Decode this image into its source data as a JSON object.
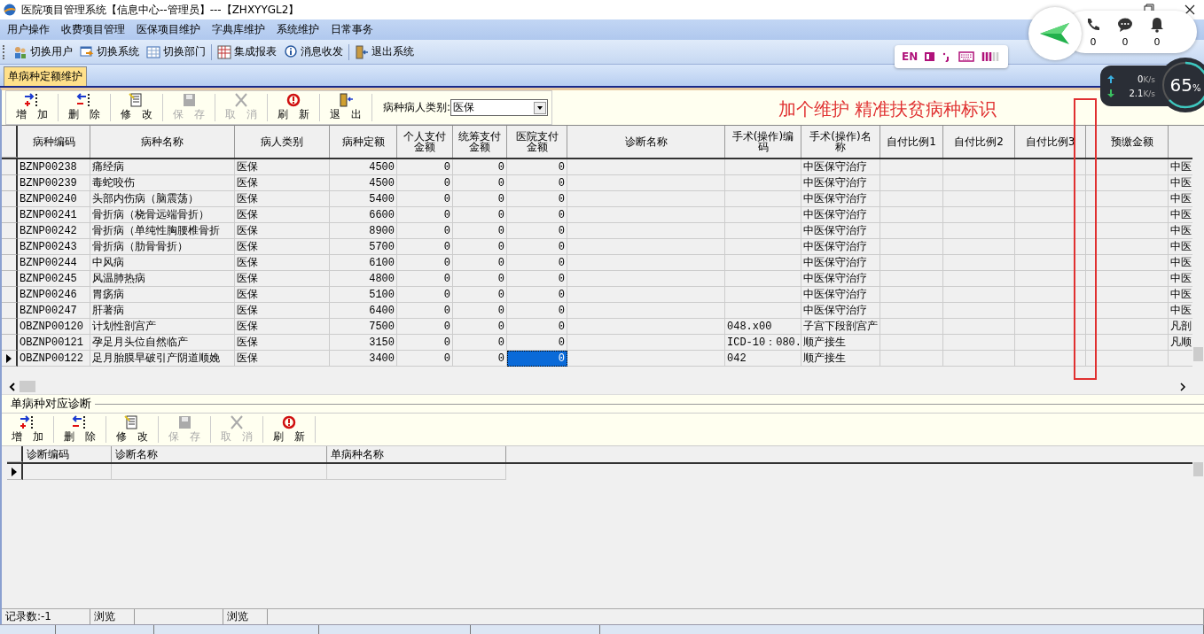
{
  "window": {
    "title": "医院项目管理系统【信息中心--管理员】---【ZHXYYGL2】"
  },
  "menu": [
    "用户操作",
    "收费项目管理",
    "医保项目维护",
    "字典库维护",
    "系统维护",
    "日常事务"
  ],
  "toolbar": [
    {
      "label": "切换用户",
      "kind": "user",
      "separator_before": false
    },
    {
      "label": "切换系统",
      "kind": "system",
      "separator_before": false
    },
    {
      "label": "切换部门",
      "kind": "dept",
      "separator_before": false
    },
    {
      "label": "集成报表",
      "kind": "report",
      "separator_before": true
    },
    {
      "label": "消息收发",
      "kind": "message",
      "separator_before": false
    },
    {
      "label": "退出系统",
      "kind": "exit",
      "separator_before": true
    }
  ],
  "tabs": [
    {
      "label": "单病种定额维护",
      "selected": true
    }
  ],
  "panel_toolbar": [
    {
      "label": "增加",
      "kind": "add",
      "disabled": false
    },
    {
      "label": "删除",
      "kind": "delete",
      "disabled": false
    },
    {
      "label": "修改",
      "kind": "edit",
      "disabled": false
    },
    {
      "label": "保存",
      "kind": "save",
      "disabled": true
    },
    {
      "label": "取消",
      "kind": "cancel",
      "disabled": true
    },
    {
      "label": "刷新",
      "kind": "refresh",
      "disabled": false
    },
    {
      "label": "退出",
      "kind": "exit",
      "disabled": false
    }
  ],
  "filter": {
    "label": "病种病人类别:",
    "value": "医保"
  },
  "annotation": "加个维护  精准扶贫病种标识",
  "grid": {
    "columns": [
      {
        "label": "病种编码",
        "focused": false
      },
      {
        "label": "病种名称",
        "focused": false
      },
      {
        "label": "病人类别",
        "focused": false
      },
      {
        "label": "病种定额",
        "focused": false
      },
      {
        "label": "个人支付金额",
        "focused": false
      },
      {
        "label": "统筹支付金额",
        "focused": false
      },
      {
        "label": "医院支付金额",
        "focused": true
      },
      {
        "label": "诊断名称",
        "focused": false
      },
      {
        "label": "手术(操作)编码",
        "focused": false
      },
      {
        "label": "手术(操作)名称",
        "focused": false
      },
      {
        "label": "自付比例1",
        "focused": false
      },
      {
        "label": "自付比例2",
        "focused": false
      },
      {
        "label": "自付比例3",
        "focused": false
      },
      {
        "label": "预缴金额",
        "focused": false
      }
    ],
    "rows": [
      {
        "selected": false,
        "code": "BZNP00238",
        "name": "痛经病",
        "patient_type": "医保",
        "quota": "4500",
        "personal_pay": "0",
        "pooled_pay": "0",
        "hospital_pay": "0",
        "surgery_name": "中医保守治疗",
        "column_17": "中医"
      },
      {
        "selected": false,
        "code": "BZNP00239",
        "name": "毒蛇咬伤",
        "patient_type": "医保",
        "quota": "4500",
        "personal_pay": "0",
        "pooled_pay": "0",
        "hospital_pay": "0",
        "surgery_name": "中医保守治疗",
        "column_17": "中医"
      },
      {
        "selected": false,
        "code": "BZNP00240",
        "name": "头部内伤病（脑震荡）",
        "patient_type": "医保",
        "quota": "5400",
        "personal_pay": "0",
        "pooled_pay": "0",
        "hospital_pay": "0",
        "surgery_name": "中医保守治疗",
        "column_17": "中医"
      },
      {
        "selected": false,
        "code": "BZNP00241",
        "name": "骨折病（桡骨远端骨折）",
        "patient_type": "医保",
        "quota": "6600",
        "personal_pay": "0",
        "pooled_pay": "0",
        "hospital_pay": "0",
        "surgery_name": "中医保守治疗",
        "column_17": "中医"
      },
      {
        "selected": false,
        "code": "BZNP00242",
        "name": "骨折病（单纯性胸腰椎骨折",
        "patient_type": "医保",
        "quota": "8900",
        "personal_pay": "0",
        "pooled_pay": "0",
        "hospital_pay": "0",
        "surgery_name": "中医保守治疗",
        "column_17": "中医"
      },
      {
        "selected": false,
        "code": "BZNP00243",
        "name": "骨折病（肋骨骨折）",
        "patient_type": "医保",
        "quota": "5700",
        "personal_pay": "0",
        "pooled_pay": "0",
        "hospital_pay": "0",
        "surgery_name": "中医保守治疗",
        "column_17": "中医"
      },
      {
        "selected": false,
        "code": "BZNP00244",
        "name": "中风病",
        "patient_type": "医保",
        "quota": "6100",
        "personal_pay": "0",
        "pooled_pay": "0",
        "hospital_pay": "0",
        "surgery_name": "中医保守治疗",
        "column_17": "中医"
      },
      {
        "selected": false,
        "code": "BZNP00245",
        "name": "风温肺热病",
        "patient_type": "医保",
        "quota": "4800",
        "personal_pay": "0",
        "pooled_pay": "0",
        "hospital_pay": "0",
        "surgery_name": "中医保守治疗",
        "column_17": "中医"
      },
      {
        "selected": false,
        "code": "BZNP00246",
        "name": "胃疡病",
        "patient_type": "医保",
        "quota": "5100",
        "personal_pay": "0",
        "pooled_pay": "0",
        "hospital_pay": "0",
        "surgery_name": "中医保守治疗",
        "column_17": "中医"
      },
      {
        "selected": false,
        "code": "BZNP00247",
        "name": "肝著病",
        "patient_type": "医保",
        "quota": "6400",
        "personal_pay": "0",
        "pooled_pay": "0",
        "hospital_pay": "0",
        "surgery_name": "中医保守治疗",
        "column_17": "中医"
      },
      {
        "selected": false,
        "code": "OBZNP00120",
        "name": "计划性剖宫产",
        "patient_type": "医保",
        "quota": "7500",
        "personal_pay": "0",
        "pooled_pay": "0",
        "hospital_pay": "0",
        "surgery_code": "048.x00",
        "surgery_name": "子宫下段剖宫产",
        "column_17": "凡剖"
      },
      {
        "selected": false,
        "code": "OBZNP00121",
        "name": "孕足月头位自然临产",
        "patient_type": "医保",
        "quota": "3150",
        "personal_pay": "0",
        "pooled_pay": "0",
        "hospital_pay": "0",
        "surgery_code": "ICD-10：080.",
        "surgery_name": "顺产接生",
        "column_17": "凡顺"
      },
      {
        "selected": true,
        "code": "OBZNP00122",
        "name": "足月胎膜早破引产阴道顺娩",
        "patient_type": "医保",
        "quota": "3400",
        "personal_pay": "0",
        "pooled_pay": "0",
        "hospital_pay": "0",
        "surgery_code": "042",
        "surgery_name": "顺产接生"
      }
    ]
  },
  "sub_panel": {
    "title": "单病种对应诊断",
    "toolbar": [
      {
        "label": "增加",
        "kind": "add",
        "disabled": false
      },
      {
        "label": "删除",
        "kind": "delete",
        "disabled": false
      },
      {
        "label": "修改",
        "kind": "edit",
        "disabled": false
      },
      {
        "label": "保存",
        "kind": "save",
        "disabled": true
      },
      {
        "label": "取消",
        "kind": "cancel",
        "disabled": true
      },
      {
        "label": "刷新",
        "kind": "refresh",
        "disabled": false
      }
    ],
    "columns": [
      "诊断编码",
      "诊断名称",
      "单病种名称"
    ],
    "rows": [
      {
        "selected": true
      }
    ]
  },
  "status_bar": [
    "记录数:-1",
    "浏览",
    "浏览"
  ],
  "notifications": [
    {
      "kind": "call",
      "count": "0"
    },
    {
      "kind": "chat",
      "count": "0"
    },
    {
      "kind": "bell",
      "count": "0"
    }
  ],
  "ime": {
    "label": "EN"
  },
  "net_meter": {
    "upload": "0",
    "download": "2.1",
    "upload_unit": "K/s",
    "download_unit": "K/s",
    "percent": "65",
    "percent_sign": "%"
  }
}
